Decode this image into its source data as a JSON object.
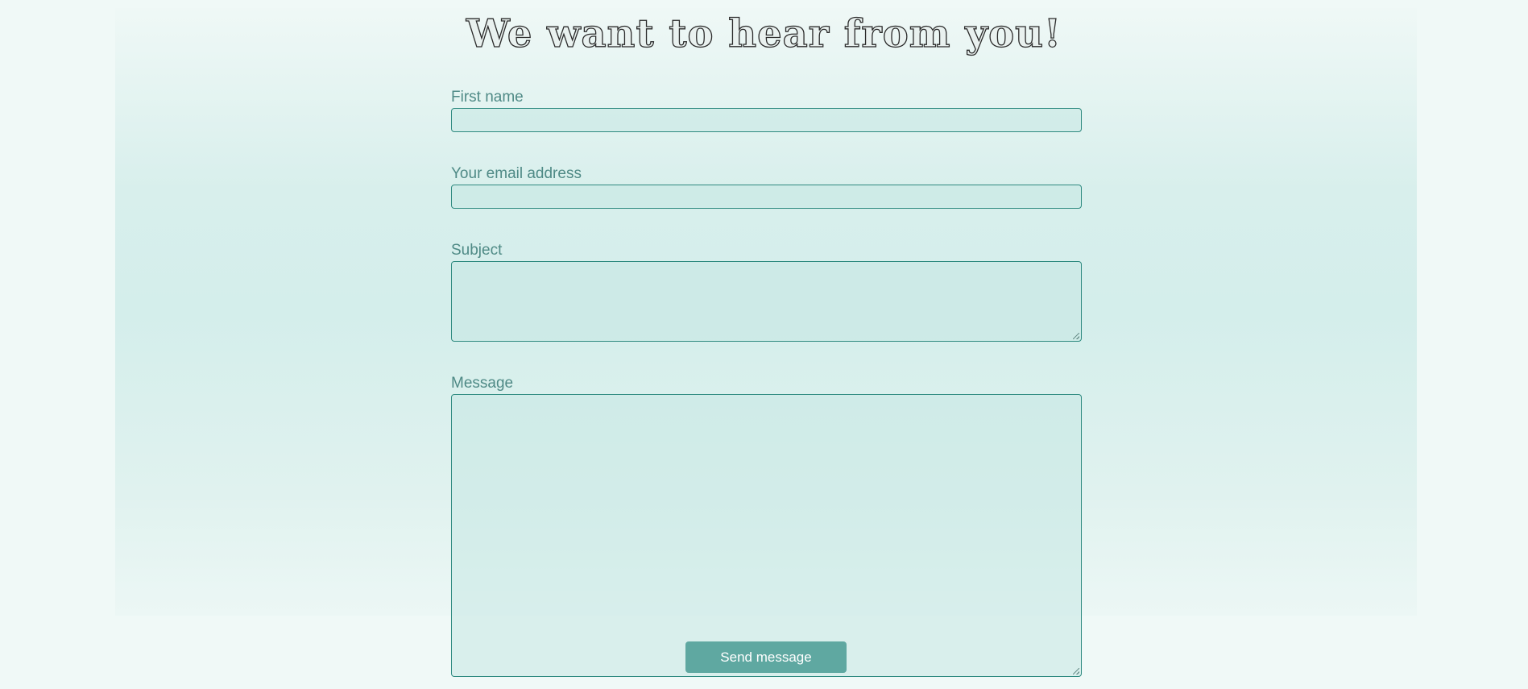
{
  "page": {
    "headline": "We want to hear from you!"
  },
  "form": {
    "first_name_label": "First name",
    "email_label": "Your email address",
    "subject_label": "Subject",
    "message_label": "Message",
    "first_name_value": "",
    "email_value": "",
    "subject_value": "",
    "message_value": "",
    "submit_label": "Send message"
  },
  "colors": {
    "accent": "#5fa8a1",
    "field_border": "#2e8a80",
    "label_text": "#4f8a86",
    "background": "#f0f9f7"
  }
}
